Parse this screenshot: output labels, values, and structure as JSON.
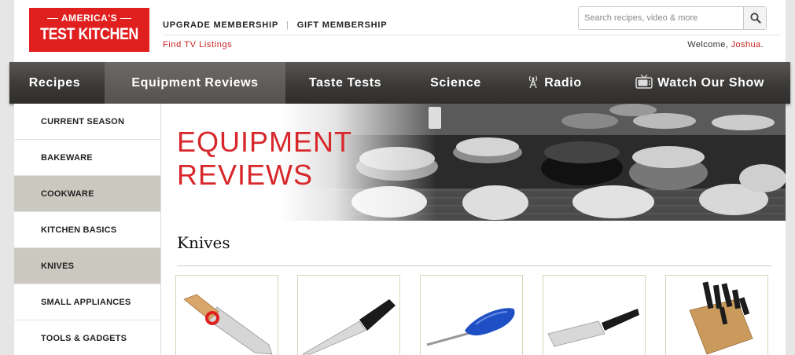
{
  "logo": {
    "line1": "AMERICA'S",
    "line2": "TEST KITCHEN"
  },
  "header": {
    "membership_links": [
      "UPGRADE MEMBERSHIP",
      "GIFT MEMBERSHIP"
    ],
    "tv_link": "Find TV Listings",
    "welcome_prefix": "Welcome, ",
    "user_name": "Joshua",
    "welcome_suffix": "."
  },
  "search": {
    "placeholder": "Search recipes, video & more",
    "icon": "magnifier-icon"
  },
  "nav": {
    "items": [
      {
        "label": "Recipes"
      },
      {
        "label": "Equipment Reviews",
        "active": true
      },
      {
        "label": "Taste Tests"
      },
      {
        "label": "Science"
      },
      {
        "label": "Radio",
        "icon": "radio-tower-icon"
      },
      {
        "label": "Watch Our Show",
        "icon": "tv-icon"
      }
    ]
  },
  "sidebar": {
    "items": [
      {
        "label": "CURRENT SEASON"
      },
      {
        "label": "BAKEWARE"
      },
      {
        "label": "COOKWARE",
        "highlighted": true
      },
      {
        "label": "KITCHEN BASICS"
      },
      {
        "label": "KNIVES",
        "highlighted": true
      },
      {
        "label": "SMALL APPLIANCES"
      },
      {
        "label": "TOOLS & GADGETS"
      }
    ]
  },
  "hero": {
    "title_line1": "EQUIPMENT",
    "title_line2": "REVIEWS"
  },
  "section": {
    "title": "Knives"
  },
  "products": [
    {
      "image": "kids-knife-wood-handle-red-guard"
    },
    {
      "image": "chefs-knife-black-handle"
    },
    {
      "image": "knife-sharpener-blue"
    },
    {
      "image": "cleaver-black-handle"
    },
    {
      "image": "knife-block-set"
    }
  ],
  "colors": {
    "brand_red": "#e0201f",
    "link_red": "#c8201f",
    "nav_dark": "#3c3a38",
    "sidebar_highlight": "#cbc9bf"
  }
}
